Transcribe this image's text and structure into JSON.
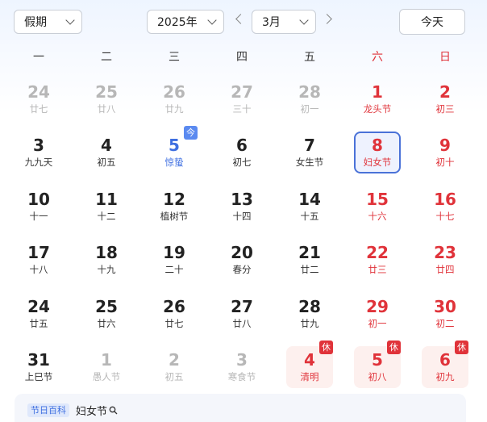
{
  "toolbar": {
    "holiday_select": "假期",
    "year_select": "2025年",
    "month_select": "3月",
    "today_button": "今天"
  },
  "weekdays": [
    "一",
    "二",
    "三",
    "四",
    "五",
    "六",
    "日"
  ],
  "weeks": [
    [
      {
        "day": "24",
        "lunar": "廿七",
        "type": "other"
      },
      {
        "day": "25",
        "lunar": "廿八",
        "type": "other"
      },
      {
        "day": "26",
        "lunar": "廿九",
        "type": "other"
      },
      {
        "day": "27",
        "lunar": "三十",
        "type": "other"
      },
      {
        "day": "28",
        "lunar": "初一",
        "type": "other"
      },
      {
        "day": "1",
        "lunar": "龙头节",
        "type": "weekend-festival"
      },
      {
        "day": "2",
        "lunar": "初三",
        "type": "weekend"
      }
    ],
    [
      {
        "day": "3",
        "lunar": "九九天",
        "type": "normal"
      },
      {
        "day": "4",
        "lunar": "初五",
        "type": "normal"
      },
      {
        "day": "5",
        "lunar": "惊蛰",
        "type": "jieqi",
        "badge": "今"
      },
      {
        "day": "6",
        "lunar": "初七",
        "type": "normal"
      },
      {
        "day": "7",
        "lunar": "女生节",
        "type": "normal"
      },
      {
        "day": "8",
        "lunar": "妇女节",
        "type": "selected"
      },
      {
        "day": "9",
        "lunar": "初十",
        "type": "weekend"
      }
    ],
    [
      {
        "day": "10",
        "lunar": "十一",
        "type": "normal"
      },
      {
        "day": "11",
        "lunar": "十二",
        "type": "normal"
      },
      {
        "day": "12",
        "lunar": "植树节",
        "type": "normal"
      },
      {
        "day": "13",
        "lunar": "十四",
        "type": "normal"
      },
      {
        "day": "14",
        "lunar": "十五",
        "type": "normal"
      },
      {
        "day": "15",
        "lunar": "十六",
        "type": "weekend"
      },
      {
        "day": "16",
        "lunar": "十七",
        "type": "weekend"
      }
    ],
    [
      {
        "day": "17",
        "lunar": "十八",
        "type": "normal"
      },
      {
        "day": "18",
        "lunar": "十九",
        "type": "normal"
      },
      {
        "day": "19",
        "lunar": "二十",
        "type": "normal"
      },
      {
        "day": "20",
        "lunar": "春分",
        "type": "normal"
      },
      {
        "day": "21",
        "lunar": "廿二",
        "type": "normal"
      },
      {
        "day": "22",
        "lunar": "廿三",
        "type": "weekend"
      },
      {
        "day": "23",
        "lunar": "廿四",
        "type": "weekend"
      }
    ],
    [
      {
        "day": "24",
        "lunar": "廿五",
        "type": "normal"
      },
      {
        "day": "25",
        "lunar": "廿六",
        "type": "normal"
      },
      {
        "day": "26",
        "lunar": "廿七",
        "type": "normal"
      },
      {
        "day": "27",
        "lunar": "廿八",
        "type": "normal"
      },
      {
        "day": "28",
        "lunar": "廿九",
        "type": "normal"
      },
      {
        "day": "29",
        "lunar": "初一",
        "type": "weekend"
      },
      {
        "day": "30",
        "lunar": "初二",
        "type": "weekend"
      }
    ],
    [
      {
        "day": "31",
        "lunar": "上巳节",
        "type": "normal"
      },
      {
        "day": "1",
        "lunar": "愚人节",
        "type": "other"
      },
      {
        "day": "2",
        "lunar": "初五",
        "type": "other"
      },
      {
        "day": "3",
        "lunar": "寒食节",
        "type": "other"
      },
      {
        "day": "4",
        "lunar": "清明",
        "type": "holiday",
        "badge": "休"
      },
      {
        "day": "5",
        "lunar": "初八",
        "type": "holiday",
        "badge": "休"
      },
      {
        "day": "6",
        "lunar": "初九",
        "type": "holiday",
        "badge": "休"
      }
    ]
  ],
  "footer": {
    "tag": "节日百科",
    "text": "妇女节"
  },
  "colors": {
    "weekend_red": "#e0333a",
    "jieqi_blue": "#3d6ee0",
    "selected_border": "#4a72d8",
    "holiday_bg": "#fdf0ee"
  }
}
